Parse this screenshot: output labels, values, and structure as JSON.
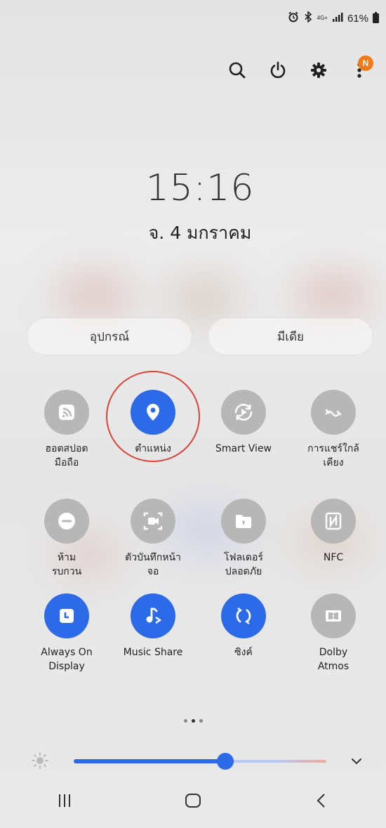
{
  "status_bar": {
    "alarm_icon": "alarm-icon",
    "bluetooth_icon": "bluetooth-icon",
    "network_label": "4G+",
    "signal_icon": "signal-icon",
    "battery_percent": "61%"
  },
  "top_actions": {
    "search": "search-icon",
    "power": "power-icon",
    "settings": "gear-icon",
    "more": "more-icon",
    "notification_badge": "N"
  },
  "clock": {
    "time": "15:16",
    "date": "จ. 4 มกราคม"
  },
  "pills": {
    "devices": "อุปกรณ์",
    "media": "มีเดีย"
  },
  "tiles": [
    {
      "label_line1": "ฮอตสปอต",
      "label_line2": "มือถือ",
      "on": false,
      "icon": "hotspot-icon"
    },
    {
      "label_line1": "ตำแหน่ง",
      "label_line2": "",
      "on": true,
      "icon": "location-pin-icon"
    },
    {
      "label_line1": "Smart View",
      "label_line2": "",
      "on": false,
      "icon": "smart-view-icon"
    },
    {
      "label_line1": "การแชร์ใกล้",
      "label_line2": "เคียง",
      "on": false,
      "icon": "nearby-share-icon"
    },
    {
      "label_line1": "ห้าม",
      "label_line2": "รบกวน",
      "on": false,
      "icon": "do-not-disturb-icon"
    },
    {
      "label_line1": "ตัวบันทึกหน้า",
      "label_line2": "จอ",
      "on": false,
      "icon": "screen-recorder-icon"
    },
    {
      "label_line1": "โฟลเดอร์",
      "label_line2": "ปลอดภัย",
      "on": false,
      "icon": "secure-folder-icon"
    },
    {
      "label_line1": "NFC",
      "label_line2": "",
      "on": false,
      "icon": "nfc-icon"
    },
    {
      "label_line1": "Always On",
      "label_line2": "Display",
      "on": true,
      "icon": "always-on-display-icon"
    },
    {
      "label_line1": "Music Share",
      "label_line2": "",
      "on": true,
      "icon": "music-share-icon"
    },
    {
      "label_line1": "ซิงค์",
      "label_line2": "",
      "on": true,
      "icon": "sync-icon"
    },
    {
      "label_line1": "Dolby",
      "label_line2": "Atmos",
      "on": false,
      "icon": "dolby-atmos-icon"
    }
  ],
  "pager": {
    "pages": 3,
    "active": 1
  },
  "brightness": {
    "level": 0.6,
    "icon": "brightness-icon",
    "expand_icon": "chevron-down-icon"
  },
  "colors": {
    "accent": "#2d6ae8",
    "tile_off": "#b7b7b7",
    "highlight": "#d9443a",
    "badge": "#f07a19"
  },
  "navbar": {
    "recent": "recent-apps-icon",
    "home": "home-icon",
    "back": "back-icon"
  }
}
